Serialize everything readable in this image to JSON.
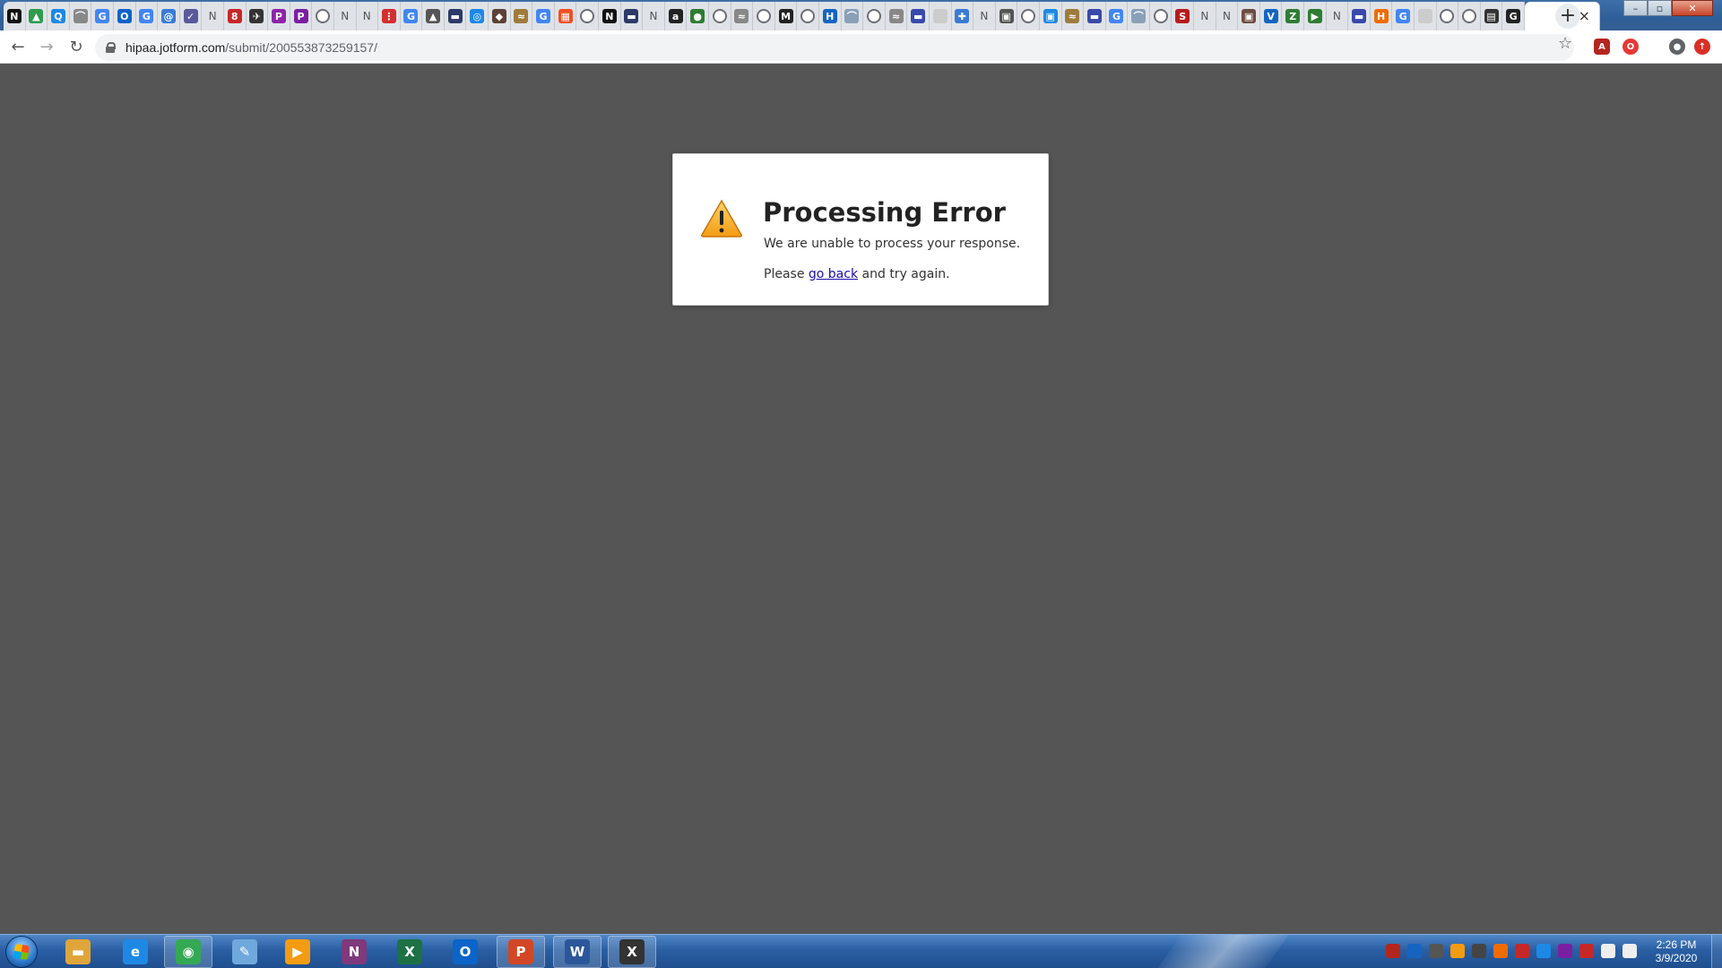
{
  "browser": {
    "tabs": [
      {
        "icon": "N",
        "color": "#111111",
        "name": "tab-favicon-n"
      },
      {
        "icon": "▲",
        "color": "#2e9b4e",
        "name": "tab-favicon-drive"
      },
      {
        "icon": "Q",
        "color": "#1e88e5",
        "name": "tab-favicon-q"
      },
      {
        "icon": "⌒",
        "color": "#888888",
        "name": "tab-favicon-arc"
      },
      {
        "icon": "G",
        "color": "#4285f4",
        "name": "tab-favicon-google"
      },
      {
        "icon": "O",
        "color": "#0a64c9",
        "name": "tab-favicon-outlook"
      },
      {
        "icon": "G",
        "color": "#4285f4",
        "name": "tab-favicon-google"
      },
      {
        "icon": "@",
        "color": "#3a7bd5",
        "name": "tab-favicon-at"
      },
      {
        "icon": "✓",
        "color": "#5a5a9a",
        "name": "tab-favicon-check"
      },
      {
        "icon": "N",
        "color": "#666666",
        "name": "tab-favicon-n-letter"
      },
      {
        "icon": "8",
        "color": "#c62828",
        "name": "tab-favicon-red"
      },
      {
        "icon": "✈",
        "color": "#333333",
        "name": "tab-favicon-plane"
      },
      {
        "icon": "P",
        "color": "#8e24aa",
        "name": "tab-favicon-p"
      },
      {
        "icon": "P",
        "color": "#7b1fa2",
        "name": "tab-favicon-p"
      },
      {
        "icon": "◐",
        "color": "#6b6f74",
        "name": "tab-favicon-globe"
      },
      {
        "icon": "N",
        "color": "#666666",
        "name": "tab-favicon-n-letter"
      },
      {
        "icon": "N",
        "color": "#666666",
        "name": "tab-favicon-n-letter"
      },
      {
        "icon": "⋮",
        "color": "#d32f2f",
        "name": "tab-favicon-grid"
      },
      {
        "icon": "G",
        "color": "#4285f4",
        "name": "tab-favicon-google"
      },
      {
        "icon": "▲",
        "color": "#555555",
        "name": "tab-favicon-a"
      },
      {
        "icon": "▬",
        "color": "#2b3a67",
        "name": "tab-favicon-card"
      },
      {
        "icon": "◎",
        "color": "#1e88e5",
        "name": "tab-favicon-circle"
      },
      {
        "icon": "◆",
        "color": "#5d4037",
        "name": "tab-favicon-ups"
      },
      {
        "icon": "≈",
        "color": "#9e7b3b",
        "name": "tab-favicon-wave"
      },
      {
        "icon": "G",
        "color": "#4285f4",
        "name": "tab-favicon-google"
      },
      {
        "icon": "▦",
        "color": "#f25022",
        "name": "tab-favicon-windows"
      },
      {
        "icon": "◐",
        "color": "#6b6f74",
        "name": "tab-favicon-globe"
      },
      {
        "icon": "N",
        "color": "#111111",
        "name": "tab-favicon-n"
      },
      {
        "icon": "▬",
        "color": "#2b3a67",
        "name": "tab-favicon-card"
      },
      {
        "icon": "N",
        "color": "#666666",
        "name": "tab-favicon-n-letter"
      },
      {
        "icon": "a",
        "color": "#222222",
        "name": "tab-favicon-amazon"
      },
      {
        "icon": "●",
        "color": "#2e7d32",
        "name": "tab-favicon-green"
      },
      {
        "icon": "◐",
        "color": "#6b6f74",
        "name": "tab-favicon-globe"
      },
      {
        "icon": "≈",
        "color": "#888888",
        "name": "tab-favicon-wave"
      },
      {
        "icon": "◐",
        "color": "#6b6f74",
        "name": "tab-favicon-globe"
      },
      {
        "icon": "M",
        "color": "#222222",
        "name": "tab-favicon-m"
      },
      {
        "icon": "◐",
        "color": "#6b6f74",
        "name": "tab-favicon-globe"
      },
      {
        "icon": "H",
        "color": "#1565c0",
        "name": "tab-favicon-h"
      },
      {
        "icon": "⌒",
        "color": "#8aa0b8",
        "name": "tab-favicon-arc"
      },
      {
        "icon": "◐",
        "color": "#6b6f74",
        "name": "tab-favicon-globe"
      },
      {
        "icon": "≈",
        "color": "#888888",
        "name": "tab-favicon-wave"
      },
      {
        "icon": "▬",
        "color": "#3949ab",
        "name": "tab-favicon-card"
      },
      {
        "icon": " ",
        "color": "#cccccc",
        "name": "tab-favicon-blank"
      },
      {
        "icon": "✚",
        "color": "#3a7bd5",
        "name": "tab-favicon-plus"
      },
      {
        "icon": "N",
        "color": "#666666",
        "name": "tab-favicon-n-letter"
      },
      {
        "icon": "▣",
        "color": "#555555",
        "name": "tab-favicon-box"
      },
      {
        "icon": "◐",
        "color": "#6b6f74",
        "name": "tab-favicon-globe"
      },
      {
        "icon": "▣",
        "color": "#1e88e5",
        "name": "tab-favicon-box-blue"
      },
      {
        "icon": "≈",
        "color": "#9e7b3b",
        "name": "tab-favicon-wave"
      },
      {
        "icon": "▬",
        "color": "#3949ab",
        "name": "tab-favicon-card"
      },
      {
        "icon": "G",
        "color": "#4285f4",
        "name": "tab-favicon-google"
      },
      {
        "icon": "⌒",
        "color": "#8aa0b8",
        "name": "tab-favicon-arc"
      },
      {
        "icon": "◐",
        "color": "#6b6f74",
        "name": "tab-favicon-globe"
      },
      {
        "icon": "S",
        "color": "#b71c1c",
        "name": "tab-favicon-s"
      },
      {
        "icon": "N",
        "color": "#666666",
        "name": "tab-favicon-n-letter"
      },
      {
        "icon": "N",
        "color": "#666666",
        "name": "tab-favicon-n-letter"
      },
      {
        "icon": "▣",
        "color": "#6d4c41",
        "name": "tab-favicon-bag"
      },
      {
        "icon": "V",
        "color": "#1565c0",
        "name": "tab-favicon-v"
      },
      {
        "icon": "Z",
        "color": "#2e7d32",
        "name": "tab-favicon-z"
      },
      {
        "icon": "▶",
        "color": "#2e7d32",
        "name": "tab-favicon-arrow"
      },
      {
        "icon": "N",
        "color": "#666666",
        "name": "tab-favicon-n-letter"
      },
      {
        "icon": "▬",
        "color": "#3949ab",
        "name": "tab-favicon-card"
      },
      {
        "icon": "H",
        "color": "#ef6c00",
        "name": "tab-favicon-orange"
      },
      {
        "icon": "G",
        "color": "#4285f4",
        "name": "tab-favicon-google"
      },
      {
        "icon": " ",
        "color": "#cccccc",
        "name": "tab-favicon-blank"
      },
      {
        "icon": "◐",
        "color": "#6b6f74",
        "name": "tab-favicon-globe"
      },
      {
        "icon": "◐",
        "color": "#6b6f74",
        "name": "tab-favicon-globe"
      },
      {
        "icon": "▤",
        "color": "#333333",
        "name": "tab-favicon-film"
      },
      {
        "icon": "G",
        "color": "#222222",
        "name": "tab-favicon-g-dark"
      }
    ],
    "active_tab_close": "×",
    "new_tab": "+",
    "window_controls": {
      "minimize": "–",
      "maximize": "▫",
      "close": "✕"
    },
    "nav": {
      "back": "←",
      "forward": "→",
      "reload": "↻"
    },
    "url": {
      "host": "hipaa.jotform.com",
      "path": "/submit/200553873259157/"
    },
    "star": "☆",
    "extensions": [
      {
        "name": "acrobat-extension-icon",
        "glyph": "A",
        "color": "#b3261e"
      },
      {
        "name": "opera-extension-icon",
        "glyph": "O",
        "color": "#e53935"
      },
      {
        "name": "profile-icon",
        "glyph": "●",
        "color": "#5f6368"
      },
      {
        "name": "update-icon",
        "glyph": "↑",
        "color": "#d93025"
      }
    ]
  },
  "error": {
    "title": "Processing Error",
    "message": "We are unable to process your response.",
    "retry_prefix": "Please ",
    "retry_link": "go back",
    "retry_suffix": " and try again."
  },
  "taskbar": {
    "apps": [
      {
        "name": "explorer",
        "glyph": "▬",
        "color": "#e0a53a",
        "open": false
      },
      {
        "name": "internet-explorer",
        "glyph": "e",
        "color": "#1e88e5",
        "open": false
      },
      {
        "name": "chrome",
        "glyph": "◉",
        "color": "#34a853",
        "open": true
      },
      {
        "name": "paint",
        "glyph": "✎",
        "color": "#6fa8dc",
        "open": false
      },
      {
        "name": "media-player",
        "glyph": "▶",
        "color": "#f39c12",
        "open": false
      },
      {
        "name": "onenote",
        "glyph": "N",
        "color": "#80397b",
        "open": false
      },
      {
        "name": "excel",
        "glyph": "X",
        "color": "#1e7145",
        "open": false
      },
      {
        "name": "outlook",
        "glyph": "O",
        "color": "#0a64c9",
        "open": false
      },
      {
        "name": "powerpoint",
        "glyph": "P",
        "color": "#d24726",
        "open": true
      },
      {
        "name": "word",
        "glyph": "W",
        "color": "#2b579a",
        "open": true
      },
      {
        "name": "x-app",
        "glyph": "X",
        "color": "#333333",
        "open": true
      }
    ],
    "tray_colors": [
      "#b3261e",
      "#1565c0",
      "#555555",
      "#f39c12",
      "#444444",
      "#ef6c00",
      "#c62828",
      "#1e88e5",
      "#7b1fa2",
      "#c62828",
      "#eeeeee",
      "#eeeeee"
    ],
    "time": "2:26 PM",
    "date": "3/9/2020"
  }
}
